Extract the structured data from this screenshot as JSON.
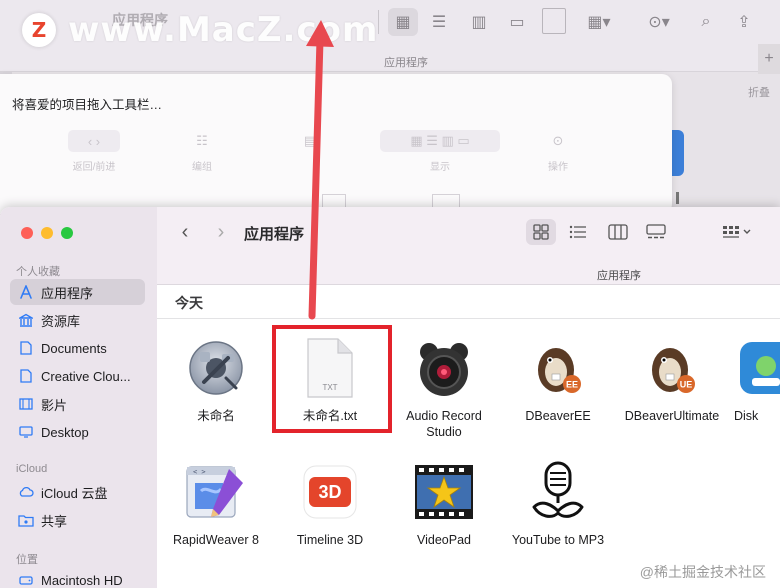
{
  "watermark": {
    "logo_letter": "Z",
    "text": "www.MacZ.com"
  },
  "background_window": {
    "title_ghost": "应用程序",
    "subtitle": "应用程序",
    "collapse_label": "折叠",
    "sheet": {
      "title": "将喜爱的项目拖入工具栏…",
      "items": [
        {
          "label": "返回/前进"
        },
        {
          "label": "编组"
        },
        {
          "label": "显示"
        },
        {
          "label": "操作"
        }
      ]
    }
  },
  "finder": {
    "title": "应用程序",
    "path_subtitle": "应用程序",
    "sidebar": {
      "favorites_label": "个人收藏",
      "favorites": [
        {
          "label": "应用程序",
          "icon": "apps-icon",
          "active": true
        },
        {
          "label": "资源库",
          "icon": "library-icon"
        },
        {
          "label": "Documents",
          "icon": "document-icon"
        },
        {
          "label": "Creative Clou...",
          "icon": "document-icon"
        },
        {
          "label": "影片",
          "icon": "film-icon"
        },
        {
          "label": "Desktop",
          "icon": "desktop-icon"
        }
      ],
      "icloud_label": "iCloud",
      "icloud": [
        {
          "label": "iCloud 云盘",
          "icon": "cloud-icon"
        },
        {
          "label": "共享",
          "icon": "shared-folder-icon"
        }
      ],
      "locations_label": "位置",
      "locations": [
        {
          "label": "Macintosh HD",
          "icon": "disk-icon"
        }
      ]
    },
    "group_header": "今天",
    "files": [
      {
        "label": "未命名",
        "icon": "automator-icon"
      },
      {
        "label": "未命名.txt",
        "icon": "txt-document-icon",
        "badge": "TXT"
      },
      {
        "label": "Audio Record\nStudio",
        "icon": "audio-record-icon"
      },
      {
        "label": "DBeaverEE",
        "icon": "dbeaver-icon",
        "badge": "EE"
      },
      {
        "label": "DBeaverUltimate",
        "icon": "dbeaver-icon",
        "badge": "UE"
      },
      {
        "label": "Disk",
        "icon": "disk-app-icon"
      },
      {
        "label": "RapidWeaver 8",
        "icon": "rapidweaver-icon"
      },
      {
        "label": "Timeline 3D",
        "icon": "timeline3d-icon",
        "badge": "3D"
      },
      {
        "label": "VideoPad",
        "icon": "videopad-icon"
      },
      {
        "label": "YouTube to MP3",
        "icon": "youtube-mp3-icon"
      }
    ]
  },
  "corner_watermark": "@稀土掘金技术社区",
  "colors": {
    "highlight": "#e3232b",
    "arrow": "#e8484f",
    "sidebar_accent": "#2f7bf5"
  }
}
